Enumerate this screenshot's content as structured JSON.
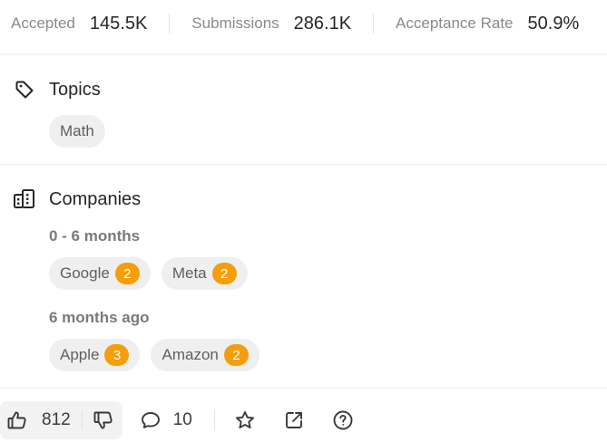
{
  "stats": {
    "accepted": {
      "label": "Accepted",
      "value": "145.5K"
    },
    "submissions": {
      "label": "Submissions",
      "value": "286.1K"
    },
    "acceptance_rate": {
      "label": "Acceptance Rate",
      "value": "50.9%"
    }
  },
  "topics": {
    "title": "Topics",
    "icon": "tag-icon",
    "items": [
      {
        "label": "Math"
      }
    ]
  },
  "companies": {
    "title": "Companies",
    "icon": "buildings-icon",
    "groups": [
      {
        "period": "0 - 6 months",
        "items": [
          {
            "name": "Google",
            "count": "2"
          },
          {
            "name": "Meta",
            "count": "2"
          }
        ]
      },
      {
        "period": "6 months ago",
        "items": [
          {
            "name": "Apple",
            "count": "3"
          },
          {
            "name": "Amazon",
            "count": "2"
          }
        ]
      }
    ],
    "badge_color": "#f59e0b"
  },
  "toolbar": {
    "likes": "812",
    "comments": "10",
    "icons": [
      "thumbs-up-icon",
      "thumbs-down-icon",
      "comment-icon",
      "star-icon",
      "share-icon",
      "help-icon"
    ]
  }
}
